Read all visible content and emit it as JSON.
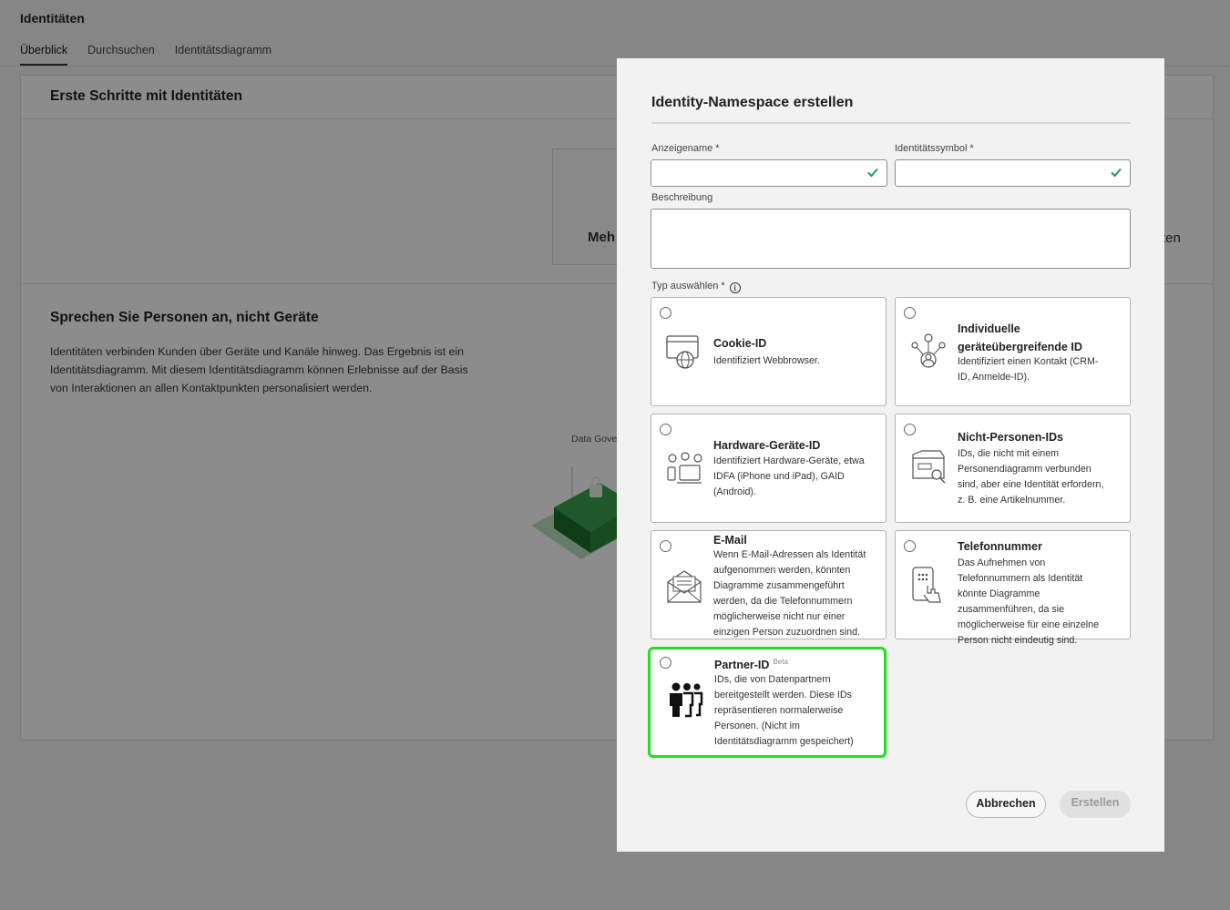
{
  "app": {
    "title": "Identitäten",
    "tabs": [
      {
        "label": "Überblick",
        "active": true
      },
      {
        "label": "Durchsuchen",
        "active": false
      },
      {
        "label": "Identitätsdiagramm",
        "active": false
      }
    ]
  },
  "background": {
    "card1_title": "Erste Schritte mit Identitäten",
    "tile_text": "Meh",
    "tile_right_text": "ten",
    "card2_title": "Sprechen Sie Personen an, nicht Geräte",
    "card2_body": "Identitäten verbinden Kunden über Geräte und Kanäle hinweg. Das Ergebnis ist ein Identitätsdiagramm. Mit diesem Identitätsdiagramm können Erlebnisse auf der Basis von Interaktionen an allen Kontaktpunkten personalisiert werden.",
    "illus_label": "Data Gover"
  },
  "modal": {
    "title": "Identity-Namespace erstellen",
    "display_name_label": "Anzeigename",
    "display_name_value": "",
    "identity_symbol_label": "Identitätssymbol",
    "identity_symbol_value": "",
    "required_mark": "*",
    "description_label": "Beschreibung",
    "description_value": "",
    "type_label": "Typ auswählen",
    "info_glyph": "i",
    "types": [
      {
        "icon": "web-browser-icon",
        "title": "Cookie-ID",
        "desc": "Identifiziert Webbrowser.",
        "selected": false
      },
      {
        "icon": "cross-device-icon",
        "title": "Individuelle geräteübergreifende ID",
        "desc": "Identifiziert einen Kontakt (CRM-ID, Anmelde-ID).",
        "selected": false
      },
      {
        "icon": "hardware-devices-icon",
        "title": "Hardware-Geräte-ID",
        "desc": "Identifiziert Hardware-Geräte, etwa IDFA (iPhone und iPad), GAID (Android).",
        "selected": false
      },
      {
        "icon": "product-box-icon",
        "title": "Nicht-Personen-IDs",
        "desc": "IDs, die nicht mit einem Personendiagramm verbunden sind, aber eine Identität erfordern, z. B. eine Artikelnummer.",
        "selected": false
      },
      {
        "icon": "email-envelope-icon",
        "title": "E-Mail",
        "desc": "Wenn E-Mail-Adressen als Identität aufgenommen werden, könnten Diagramme zusammengeführt werden, da die Telefonnummern möglicherweise nicht nur einer einzigen Person zuzuordnen sind.",
        "selected": false
      },
      {
        "icon": "phone-touch-icon",
        "title": "Telefonnummer",
        "desc": "Das Aufnehmen von Telefonnummern als Identität könnte Diagramme zusammenführen, da sie möglicherweise für eine einzelne Person nicht eindeutig sind.",
        "selected": false
      },
      {
        "icon": "people-group-icon",
        "title": "Partner-ID",
        "badge": "Beta",
        "desc": "IDs, die von Datenpartnern bereitgestellt werden. Diese IDs repräsentieren normalerweise Personen. (Nicht im Identitätsdiagramm gespeichert)",
        "selected": false,
        "highlighted": true
      }
    ],
    "cancel_label": "Abbrechen",
    "create_label": "Erstellen"
  },
  "colors": {
    "highlight": "#22e01f",
    "check": "#1f9a5a",
    "illustration_green": "#2e8b3f"
  }
}
